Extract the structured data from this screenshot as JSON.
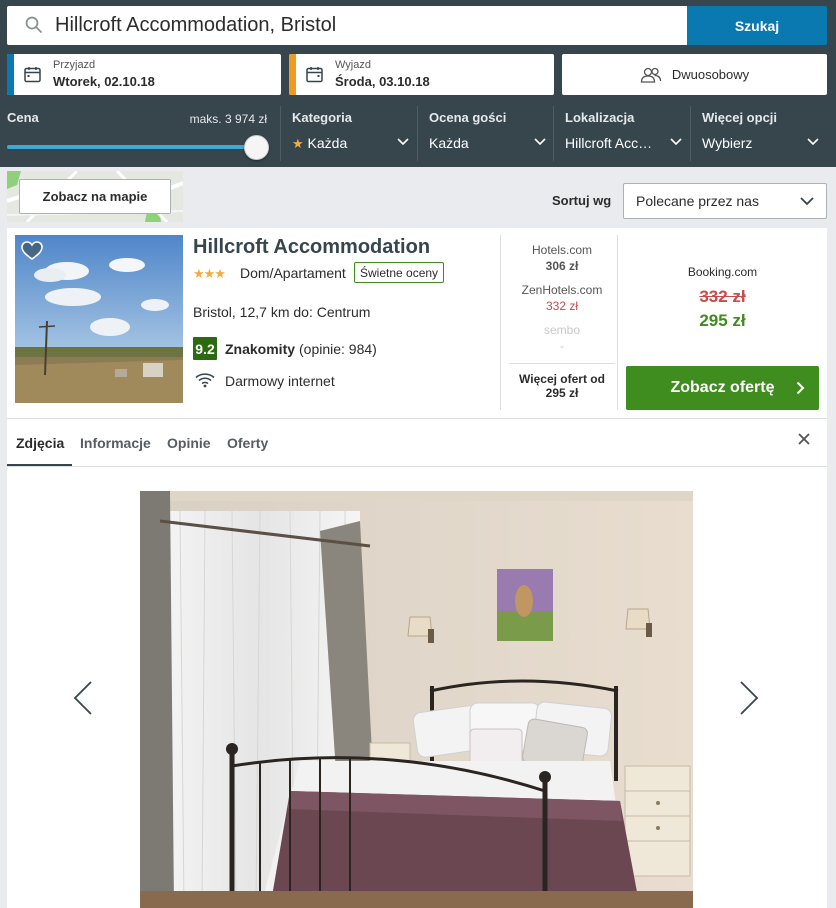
{
  "search": {
    "value": "Hillcroft Accommodation, Bristol",
    "button_label": "Szukaj"
  },
  "dates": {
    "checkin": {
      "label": "Przyjazd",
      "value": "Wtorek, 02.10.18",
      "color": "#0a79b0"
    },
    "checkout": {
      "label": "Wyjazd",
      "value": "Środa, 03.10.18",
      "color": "#f29a1f"
    }
  },
  "guests": {
    "label": "Dwuosobowy"
  },
  "filters": {
    "price": {
      "label": "Cena",
      "max_label": "maks. 3 974 zł",
      "slider_fraction": 1.0
    },
    "category": {
      "label": "Kategoria",
      "value": "Każda"
    },
    "rating": {
      "label": "Ocena gości",
      "value": "Każda"
    },
    "location": {
      "label": "Lokalizacja",
      "value": "Hillcroft Acc…"
    },
    "more": {
      "label": "Więcej opcji",
      "value": "Wybierz"
    }
  },
  "map": {
    "button_label": "Zobacz na mapie"
  },
  "sort": {
    "label": "Sortuj wg",
    "value": "Polecane przez nas"
  },
  "hotel": {
    "name": "Hillcroft Accommodation",
    "stars": "★★★",
    "star_count": 3,
    "type": "Dom/Apartament",
    "badge": "Świetne oceny",
    "location": "Bristol, 12,7 km do: Centrum",
    "rating_score": "9.2",
    "rating_word": "Znakomity",
    "rating_count": "(opinie: 984)",
    "amenity": "Darmowy internet"
  },
  "other_deals": [
    {
      "site": "Hotels.com",
      "price": "306 zł",
      "color": "#555555"
    },
    {
      "site": "ZenHotels.com",
      "price": "332 zł",
      "color": "#c94a4a"
    },
    {
      "site": "sembo",
      "price": "-",
      "color": "#c8c8c8"
    }
  ],
  "more_offers": {
    "line1": "Więcej ofert od",
    "line2": "295 zł"
  },
  "main_deal": {
    "site": "Booking.com",
    "old_price": "332 zł",
    "price": "295 zł",
    "cta_label": "Zobacz ofertę"
  },
  "tabs": [
    "Zdjęcia",
    "Informacje",
    "Opinie",
    "Oferty"
  ],
  "colors": {
    "header": "#37454d",
    "accent": "#0a79b0",
    "green": "#3f8c1f",
    "rating_green": "#2a6a10"
  }
}
